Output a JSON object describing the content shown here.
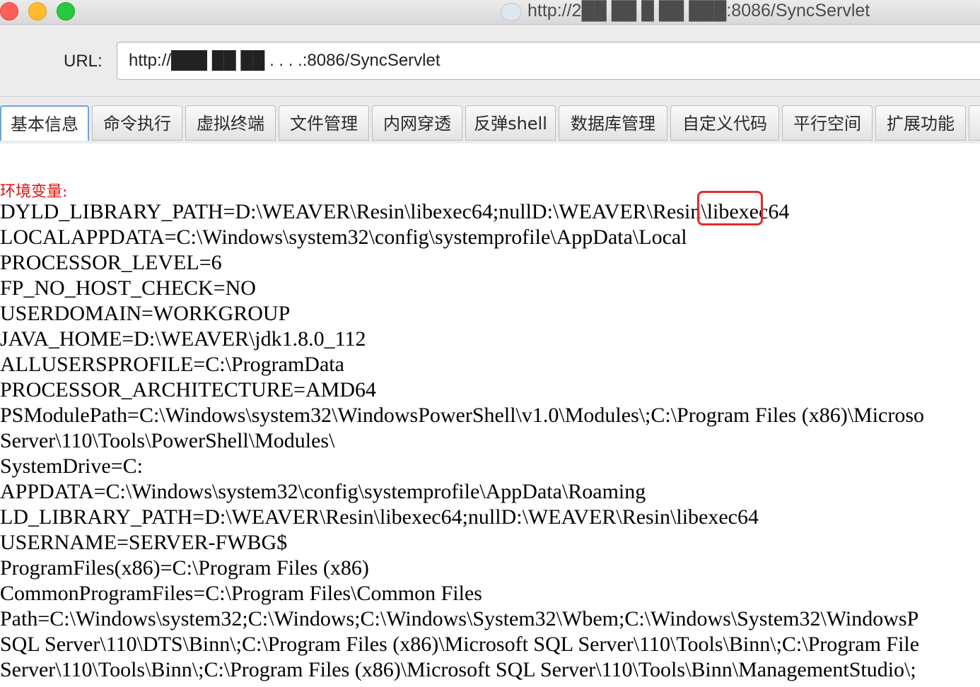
{
  "window": {
    "title": "http://2██ ██ █ ██ ███:8086/SyncServlet"
  },
  "toolbar": {
    "url_label": "URL:",
    "url_value": "http://███ ██ ██ . . . .:8086/SyncServlet"
  },
  "tabs": [
    {
      "label": "基本信息",
      "active": true
    },
    {
      "label": "命令执行",
      "active": false
    },
    {
      "label": "虚拟终端",
      "active": false
    },
    {
      "label": "文件管理",
      "active": false
    },
    {
      "label": "内网穿透",
      "active": false
    },
    {
      "label": "反弹shell",
      "active": false
    },
    {
      "label": "数据库管理",
      "active": false
    },
    {
      "label": "自定义代码",
      "active": false
    },
    {
      "label": "平行空间",
      "active": false
    },
    {
      "label": "扩展功能",
      "active": false
    }
  ],
  "content": {
    "env_title": "环境变量:",
    "lines": [
      "DYLD_LIBRARY_PATH=D:\\WEAVER\\Resin\\libexec64;nullD:\\WEAVER\\Resin\\libexec64",
      "LOCALAPPDATA=C:\\Windows\\system32\\config\\systemprofile\\AppData\\Local",
      "PROCESSOR_LEVEL=6",
      "FP_NO_HOST_CHECK=NO",
      "USERDOMAIN=WORKGROUP",
      "JAVA_HOME=D:\\WEAVER\\jdk1.8.0_112",
      "ALLUSERSPROFILE=C:\\ProgramData",
      "PROCESSOR_ARCHITECTURE=AMD64",
      "PSModulePath=C:\\Windows\\system32\\WindowsPowerShell\\v1.0\\Modules\\;C:\\Program Files (x86)\\Microso",
      "Server\\110\\Tools\\PowerShell\\Modules\\",
      "SystemDrive=C:",
      "APPDATA=C:\\Windows\\system32\\config\\systemprofile\\AppData\\Roaming",
      "LD_LIBRARY_PATH=D:\\WEAVER\\Resin\\libexec64;nullD:\\WEAVER\\Resin\\libexec64",
      "USERNAME=SERVER-FWBG$",
      "ProgramFiles(x86)=C:\\Program Files (x86)",
      "CommonProgramFiles=C:\\Program Files\\Common Files",
      "Path=C:\\Windows\\system32;C:\\Windows;C:\\Windows\\System32\\Wbem;C:\\Windows\\System32\\WindowsP",
      "SQL Server\\110\\DTS\\Binn\\;C:\\Program Files (x86)\\Microsoft SQL Server\\110\\Tools\\Binn\\;C:\\Program File",
      "Server\\110\\Tools\\Binn\\;C:\\Program Files (x86)\\Microsoft SQL Server\\110\\Tools\\Binn\\ManagementStudio\\;"
    ]
  },
  "colors": {
    "env_title": "#e0120d",
    "highlight_box": "#e52b2b",
    "active_tab_border": "#6ea3d8"
  },
  "icons": [
    "close-icon",
    "minimize-icon",
    "zoom-icon",
    "site-icon"
  ]
}
